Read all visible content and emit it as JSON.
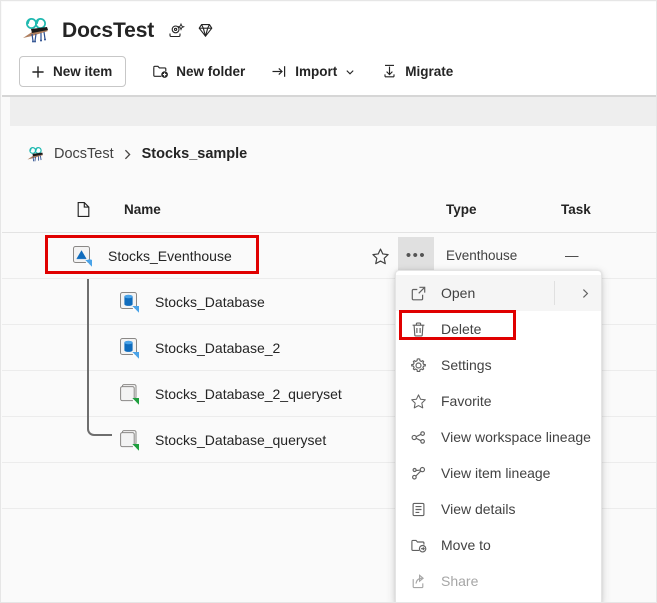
{
  "header": {
    "workspace_avatar_icon": "workspace-avatar-icon",
    "title": "DocsTest",
    "badges": [
      {
        "icon": "ai-sparkle-icon",
        "name": "copilot-badge"
      },
      {
        "icon": "diamond-icon",
        "name": "premium-capacity-badge"
      }
    ]
  },
  "commandbar": {
    "buttons": [
      {
        "label": "New item",
        "icon": "plus-icon",
        "name": "new-item-button",
        "outlined": true,
        "chevron": false
      },
      {
        "label": "New folder",
        "icon": "new-folder-icon",
        "name": "new-folder-button",
        "outlined": false,
        "chevron": false
      },
      {
        "label": "Import",
        "icon": "import-icon",
        "name": "import-button",
        "outlined": false,
        "chevron": true
      },
      {
        "label": "Migrate",
        "icon": "migrate-icon",
        "name": "migrate-button",
        "outlined": false,
        "chevron": false
      }
    ]
  },
  "breadcrumb": {
    "root_label": "DocsTest",
    "separator": "›",
    "current_label": "Stocks_sample",
    "avatar_icon": "workspace-avatar-icon"
  },
  "table": {
    "columns": {
      "file_icon": "file-type-icon",
      "name": "Name",
      "type": "Type",
      "task": "Task"
    },
    "rows": [
      {
        "name": "Stocks_Eventhouse",
        "icon": "eventhouse-icon",
        "type": "Eventhouse",
        "task": "—",
        "level": 0,
        "selected": true,
        "star_icon": "favorite-star-icon",
        "more_label": "•••"
      },
      {
        "name": "Stocks_Database",
        "icon": "kql-database-icon",
        "type": "",
        "task": "",
        "level": 1,
        "selected": false
      },
      {
        "name": "Stocks_Database_2",
        "icon": "kql-database-icon",
        "type": "",
        "task": "",
        "level": 1,
        "selected": false
      },
      {
        "name": "Stocks_Database_2_queryset",
        "icon": "kql-queryset-icon",
        "type": "",
        "task": "",
        "level": 1,
        "selected": false
      },
      {
        "name": "Stocks_Database_queryset",
        "icon": "kql-queryset-icon",
        "type": "",
        "task": "",
        "level": 1,
        "selected": false
      }
    ]
  },
  "context_menu": {
    "items": [
      {
        "label": "Open",
        "icon": "open-external-icon",
        "name": "menu-item-open",
        "state": "hover",
        "submenu": true
      },
      {
        "label": "Delete",
        "icon": "trash-icon",
        "name": "menu-item-delete",
        "state": "normal",
        "submenu": false
      },
      {
        "label": "Settings",
        "icon": "gear-icon",
        "name": "menu-item-settings",
        "state": "normal",
        "submenu": false
      },
      {
        "label": "Favorite",
        "icon": "star-icon",
        "name": "menu-item-favorite",
        "state": "normal",
        "submenu": false
      },
      {
        "label": "View workspace lineage",
        "icon": "lineage-icon",
        "name": "menu-item-view-workspace-lineage",
        "state": "normal",
        "submenu": false
      },
      {
        "label": "View item lineage",
        "icon": "item-lineage-icon",
        "name": "menu-item-view-item-lineage",
        "state": "normal",
        "submenu": false
      },
      {
        "label": "View details",
        "icon": "details-icon",
        "name": "menu-item-view-details",
        "state": "normal",
        "submenu": false
      },
      {
        "label": "Move to",
        "icon": "move-to-folder-icon",
        "name": "menu-item-move-to",
        "state": "normal",
        "submenu": false
      },
      {
        "label": "Share",
        "icon": "share-icon",
        "name": "menu-item-share",
        "state": "disabled",
        "submenu": false
      }
    ]
  },
  "annotations": {
    "highlight_color": "#e00000",
    "boxes": [
      {
        "name": "highlight-box-selected-row",
        "target": "Stocks_Eventhouse"
      },
      {
        "name": "highlight-box-delete-action",
        "target": "Delete"
      }
    ]
  }
}
